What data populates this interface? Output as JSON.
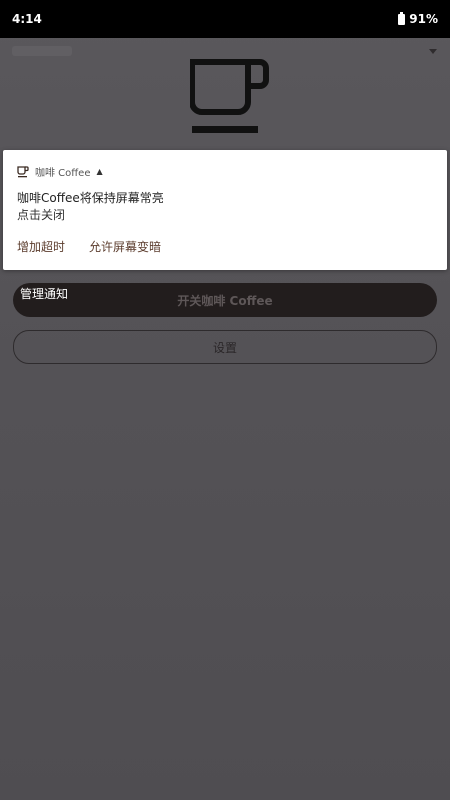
{
  "status_bar": {
    "time": "4:14",
    "battery": "91%"
  },
  "notification": {
    "app_name": "咖啡 Coffee",
    "title": "咖啡Coffee将保持屏幕常亮",
    "text": "点击关闭",
    "actions": [
      {
        "label": "增加超时"
      },
      {
        "label": "允许屏幕变暗"
      }
    ]
  },
  "main": {
    "manage_label": "管理通知",
    "toggle_label": "开关咖啡 Coffee",
    "settings_label": "设置"
  },
  "icons": {
    "cup": "coffee-cup-icon",
    "battery": "battery-icon",
    "expand": "chevron-up-icon",
    "overflow": "overflow-menu-icon"
  },
  "colors": {
    "accent": "#5c3d2e",
    "toggle_bg": "#221d1d",
    "scrim": "#4f4d51"
  }
}
